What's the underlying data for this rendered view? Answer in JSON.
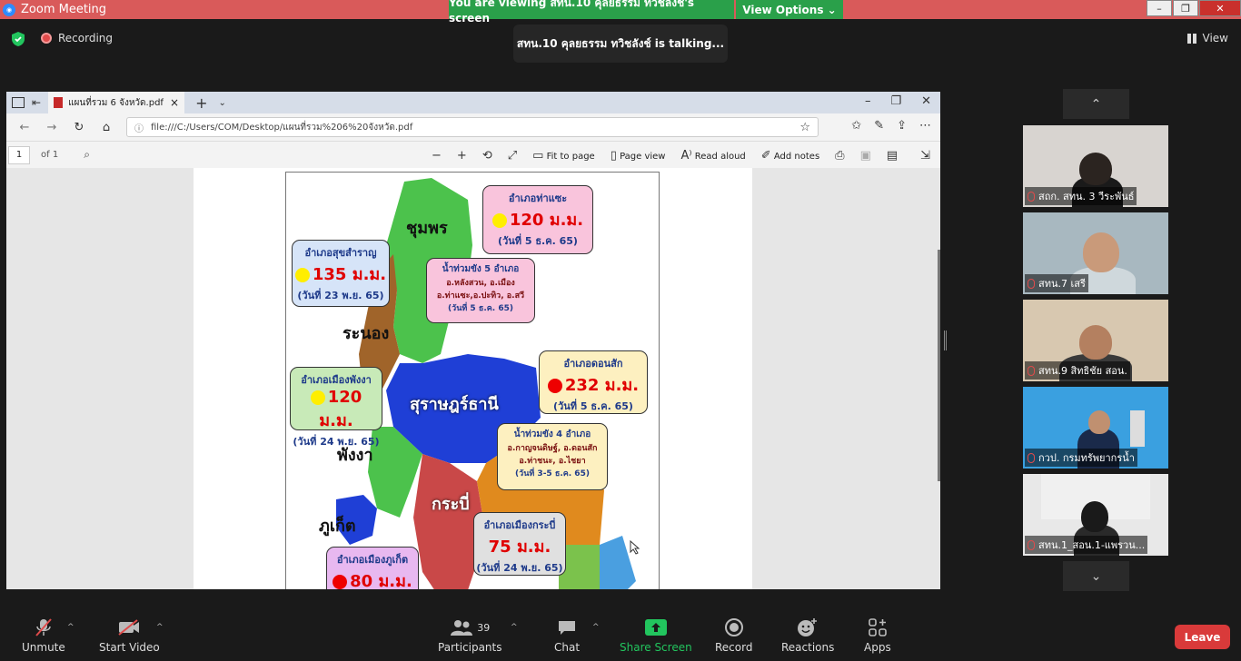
{
  "window": {
    "app_title": "Zoom Meeting",
    "viewing_banner": "You are viewing สทน.10 คุลยธรรม ทวิชลังช์'s screen",
    "view_options": "View Options ⌄",
    "minimize": "–",
    "maximize": "❐",
    "close": "✕"
  },
  "top": {
    "recording": "Recording",
    "talking": "สทน.10 คุลยธรรม ทวิชลังช์ is  talking...",
    "view": "View"
  },
  "browser": {
    "tab_title": "แผนที่รวม 6 จังหวัด.pdf",
    "url": "file:///C:/Users/COM/Desktop/แผนที่รวม%206%20จังหวัด.pdf",
    "page_number": "1",
    "page_of": "of 1",
    "tools": {
      "fit_to_page": "Fit to page",
      "page_view": "Page view",
      "read_aloud": "Read aloud",
      "add_notes": "Add notes"
    }
  },
  "map": {
    "regions": {
      "chumphon": "ชุมพร",
      "ranong": "ระนอง",
      "surat": "สุราษฎร์ธานี",
      "phangnga": "พังงา",
      "krabi": "กระบี่",
      "phuket": "ภูเก็ต"
    },
    "bubbles": {
      "thasae": {
        "name": "อำเภอท่าแซะ",
        "mm": "120 ม.ม.",
        "date": "(วันที่ 5 ธ.ค. 65)",
        "dot": "#ffee00"
      },
      "suksamran": {
        "name": "อำเภอสุขสำราญ",
        "mm": "135 ม.ม.",
        "date": "(วันที่ 23 พ.ย. 65)",
        "dot": "#ffee00"
      },
      "chumphon_note": {
        "title": "น้ำท่วมขัง 5 อำเภอ",
        "line1": "อ.หลังสวน, อ.เมือง",
        "line2": "อ.ท่าแซะ,อ.ปะทิว, อ.สวี",
        "date": "(วันที่ 5 ธ.ค. 65)"
      },
      "donsak": {
        "name": "อำเภอดอนสัก",
        "mm": "232 ม.ม.",
        "date": "(วันที่ 5 ธ.ค. 65)",
        "dot": "#ee0000"
      },
      "phangnga": {
        "name": "อำเภอเมืองพังงา",
        "mm": "120 ม.ม.",
        "date": "(วันที่ 24 พ.ย. 65)",
        "dot": "#ffee00"
      },
      "surat_note": {
        "title": "น้ำท่วมขัง 4 อำเภอ",
        "line1": "อ.กาญจนดิษฐ์, อ.ดอนสัก",
        "line2": "อ.ท่าชนะ, อ.ไชยา",
        "date": "(วันที่ 3-5 ธ.ค. 65)"
      },
      "krabi": {
        "name": "อำเภอเมืองกระบี่",
        "mm": "75 ม.ม.",
        "date": "(วันที่ 24 พ.ย. 65)"
      },
      "phuket": {
        "name": "อำเภอเมืองภูเก็ต",
        "mm": "80 ม.ม.",
        "dot": "#ee0000"
      }
    }
  },
  "participants": [
    {
      "name": "สถก. สทน. 3 วีระพันธ์"
    },
    {
      "name": "สทน.7 เสรี"
    },
    {
      "name": "สทน.9 สิทธิชัย สอน."
    },
    {
      "name": "กวป. กรมทรัพยากรน้ำ"
    },
    {
      "name": "สทน.1_สอน.1-แพรวน..."
    }
  ],
  "toolbar": {
    "unmute": "Unmute",
    "start_video": "Start Video",
    "participants": "Participants",
    "participants_count": "39",
    "chat": "Chat",
    "share_screen": "Share Screen",
    "record": "Record",
    "reactions": "Reactions",
    "apps": "Apps",
    "leave": "Leave"
  },
  "colors": {
    "titlebar": "#d95a5a",
    "banner": "#2aa04a",
    "leave": "#d93a3a",
    "share": "#22c55e"
  }
}
